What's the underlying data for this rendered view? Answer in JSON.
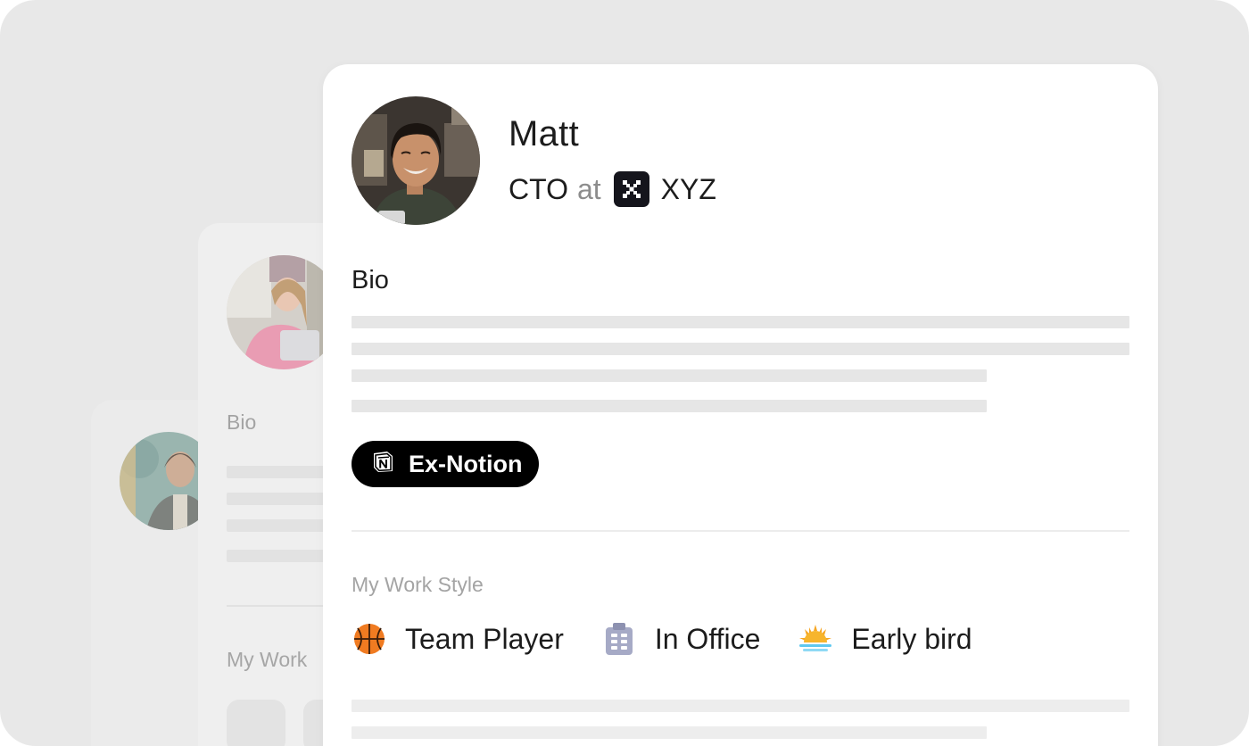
{
  "profile": {
    "name": "Matt",
    "role": "CTO",
    "at": "at",
    "company": "XYZ",
    "bio_title": "Bio",
    "badge": "Ex-Notion",
    "work_style_title": "My Work Style",
    "work_styles": [
      {
        "label": "Team Player",
        "icon": "basketball-icon"
      },
      {
        "label": "In Office",
        "icon": "office-building-icon"
      },
      {
        "label": "Early bird",
        "icon": "sunrise-icon"
      }
    ]
  },
  "background_profile": {
    "bio_title": "Bio",
    "work_style_title": "My Work"
  },
  "colors": {
    "frame": "#e8e8e8",
    "card": "#ffffff",
    "skeleton": "#e6e6e6",
    "badge_bg": "#000000",
    "text": "#1c1c1c",
    "muted": "#a4a4a4"
  }
}
